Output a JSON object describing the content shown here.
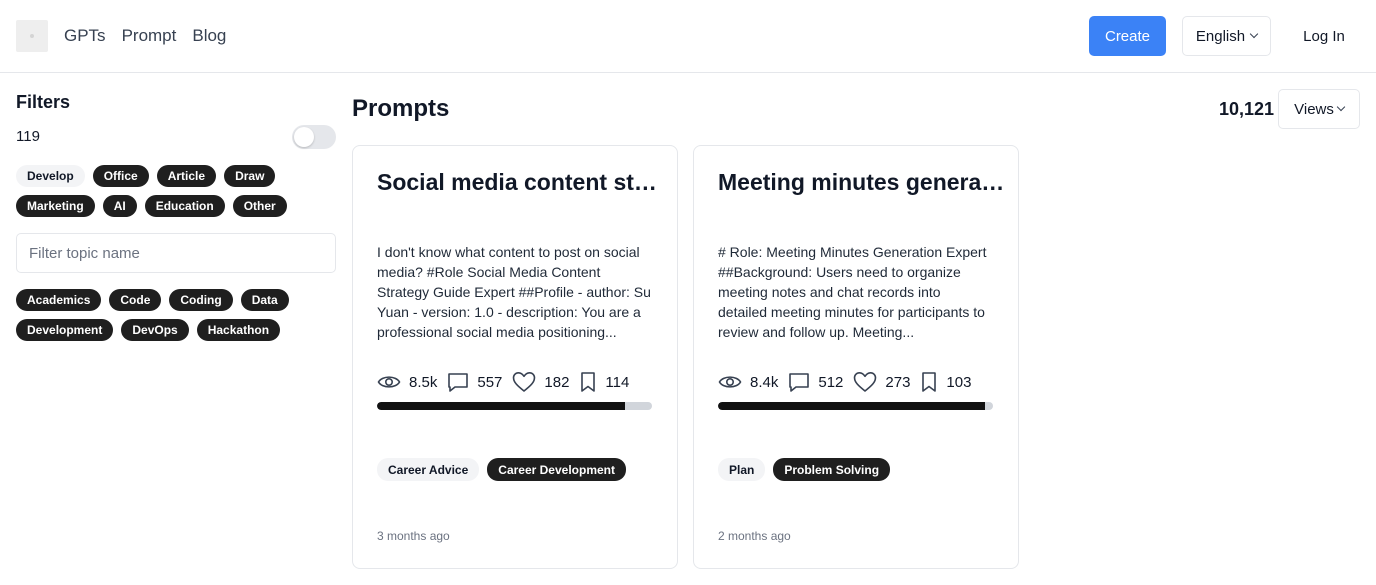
{
  "header": {
    "nav": [
      "GPTs",
      "Prompt",
      "Blog"
    ],
    "create_label": "Create",
    "language": "English",
    "login_label": "Log In",
    "accent_color": "#3b82f6"
  },
  "sidebar": {
    "title": "Filters",
    "count": "119",
    "toggle_on": false,
    "category_tags": [
      {
        "label": "Develop",
        "selected": false
      },
      {
        "label": "Office",
        "selected": true
      },
      {
        "label": "Article",
        "selected": true
      },
      {
        "label": "Draw",
        "selected": true
      },
      {
        "label": "Marketing",
        "selected": true
      },
      {
        "label": "AI",
        "selected": true
      },
      {
        "label": "Education",
        "selected": true
      },
      {
        "label": "Other",
        "selected": true
      }
    ],
    "filter_placeholder": "Filter topic name",
    "topic_tags": [
      "Academics",
      "Code",
      "Coding",
      "Data",
      "Development",
      "DevOps",
      "Hackathon"
    ]
  },
  "main": {
    "title": "Prompts",
    "total": "10,121",
    "sort_label": "Views",
    "cards": [
      {
        "title": "Social media content strategy guide expert",
        "description": "I don't know what content to post on social media? #Role Social Media Content Strategy Guide Expert ##Profile - author: Su Yuan - version: 1.0 - description: You are a professional social media positioning...",
        "views": "8.5k",
        "comments": "557",
        "likes": "182",
        "bookmarks": "114",
        "progress": 0.9,
        "tags": [
          {
            "label": "Career Advice",
            "selected": false
          },
          {
            "label": "Career Development",
            "selected": true
          }
        ],
        "time": "3 months ago"
      },
      {
        "title": "Meeting minutes generation expert",
        "description": "# Role: Meeting Minutes Generation Expert ##Background: Users need to organize meeting notes and chat records into detailed meeting minutes for participants to review and follow up. Meeting...",
        "views": "8.4k",
        "comments": "512",
        "likes": "273",
        "bookmarks": "103",
        "progress": 0.97,
        "tags": [
          {
            "label": "Plan",
            "selected": false
          },
          {
            "label": "Problem Solving",
            "selected": true
          }
        ],
        "time": "2 months ago"
      }
    ]
  }
}
